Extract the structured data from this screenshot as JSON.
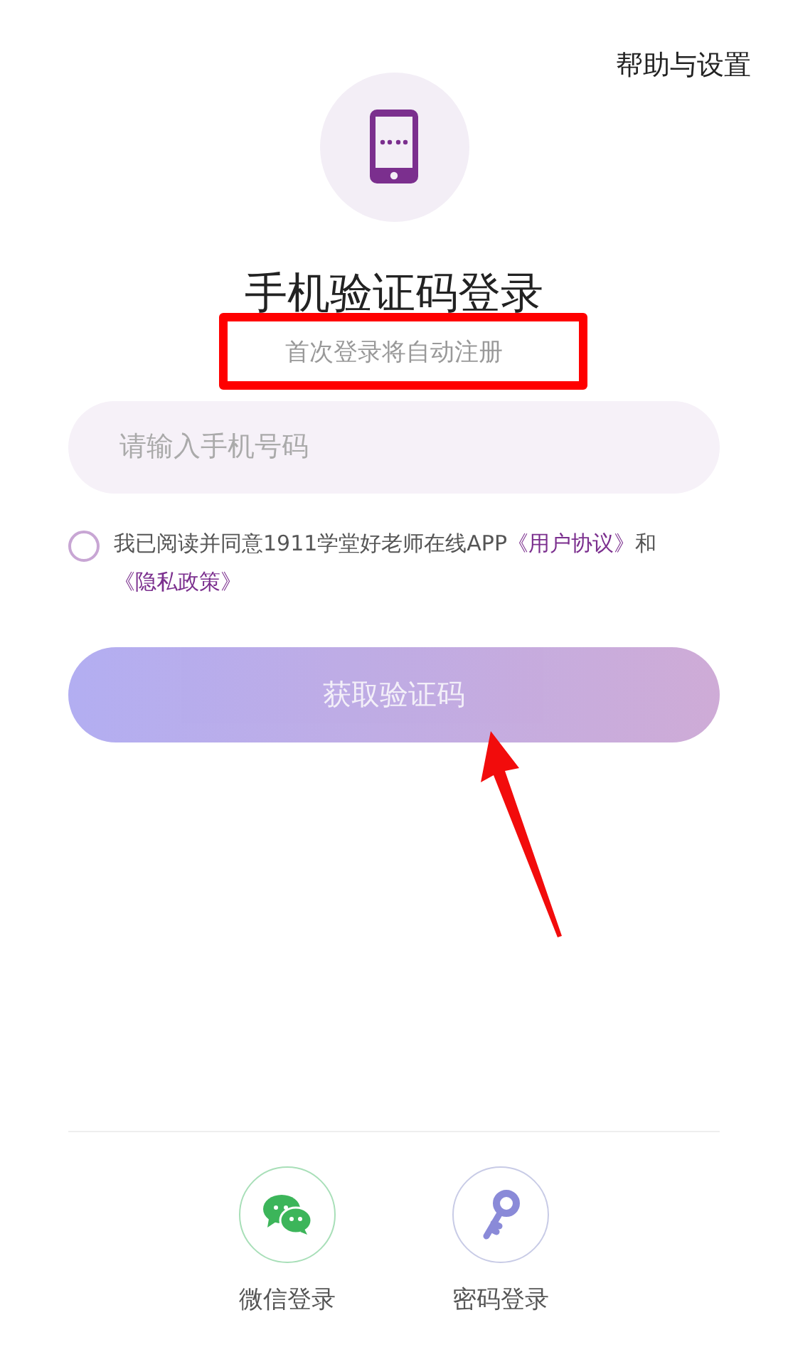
{
  "header": {
    "help_link": "帮助与设置"
  },
  "title": "手机验证码登录",
  "subtitle": "首次登录将自动注册",
  "phone_field": {
    "placeholder": "请输入手机号码"
  },
  "agreement": {
    "checked": false,
    "parts": [
      {
        "kind": "text",
        "text": "我已阅读并同意1911学堂好老师在线APP"
      },
      {
        "kind": "link",
        "text": "《用户协议》"
      },
      {
        "kind": "text",
        "text": "和"
      },
      {
        "kind": "link",
        "text": "《隐私政策》"
      }
    ]
  },
  "submit_button": {
    "label": "获取验证码",
    "disabled": true
  },
  "alt_logins": [
    {
      "kind": "wechat",
      "label": "微信登录"
    },
    {
      "kind": "password",
      "label": "密码登录"
    }
  ]
}
